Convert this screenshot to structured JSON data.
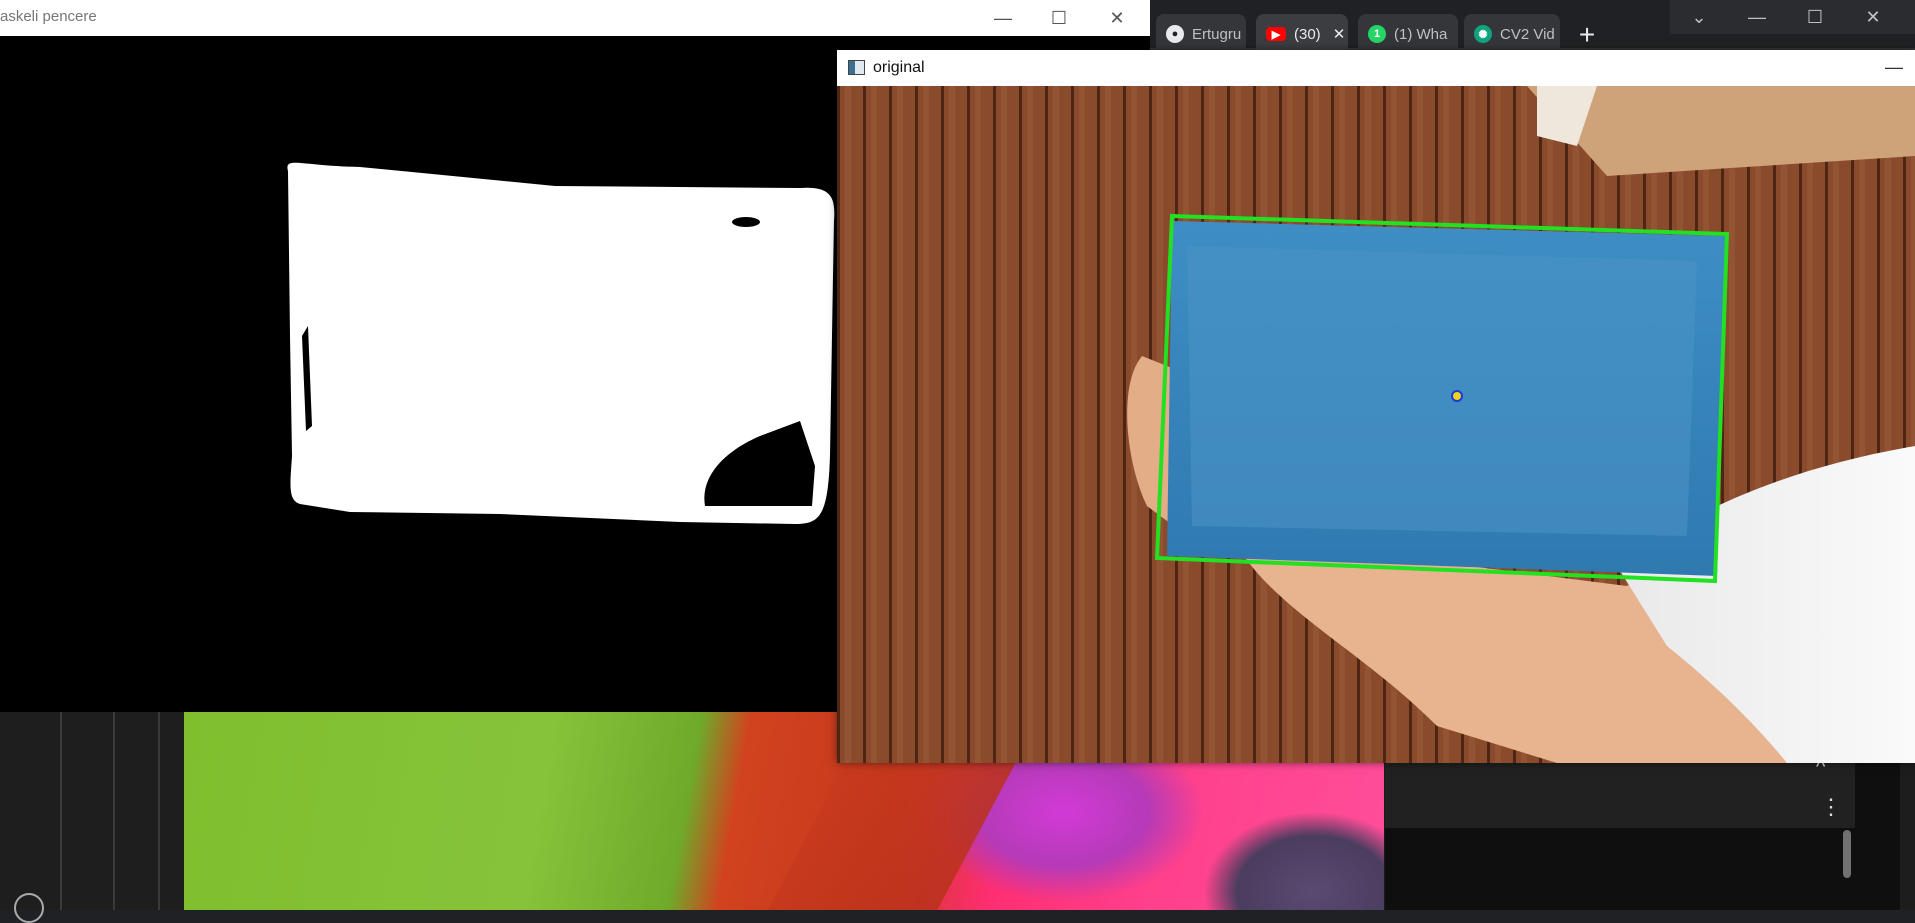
{
  "browser": {
    "tabs": [
      {
        "label": "Ertugru",
        "icon": "github-icon"
      },
      {
        "label": "(30)",
        "icon": "youtube-icon",
        "active": true
      },
      {
        "label": "(1) Wha",
        "icon": "whatsapp-icon"
      },
      {
        "label": "CV2 Vid",
        "icon": "chatgpt-icon"
      }
    ],
    "new_tab_label": "+",
    "window_controls": [
      "⌄",
      "—",
      "☐",
      "✕"
    ]
  },
  "mask_window": {
    "title": "askeli pencere",
    "controls": [
      "—",
      "☐",
      "✕"
    ]
  },
  "original_window": {
    "title": "original",
    "minimize": "—",
    "box_color": "#22e022",
    "center_dot_color": "#f2d21a"
  },
  "video_panel": {
    "collapse": "^",
    "more": "⋮"
  },
  "colors": {
    "desktop": "#202124",
    "mask_fg": "#ffffff",
    "mask_bg": "#000000"
  }
}
